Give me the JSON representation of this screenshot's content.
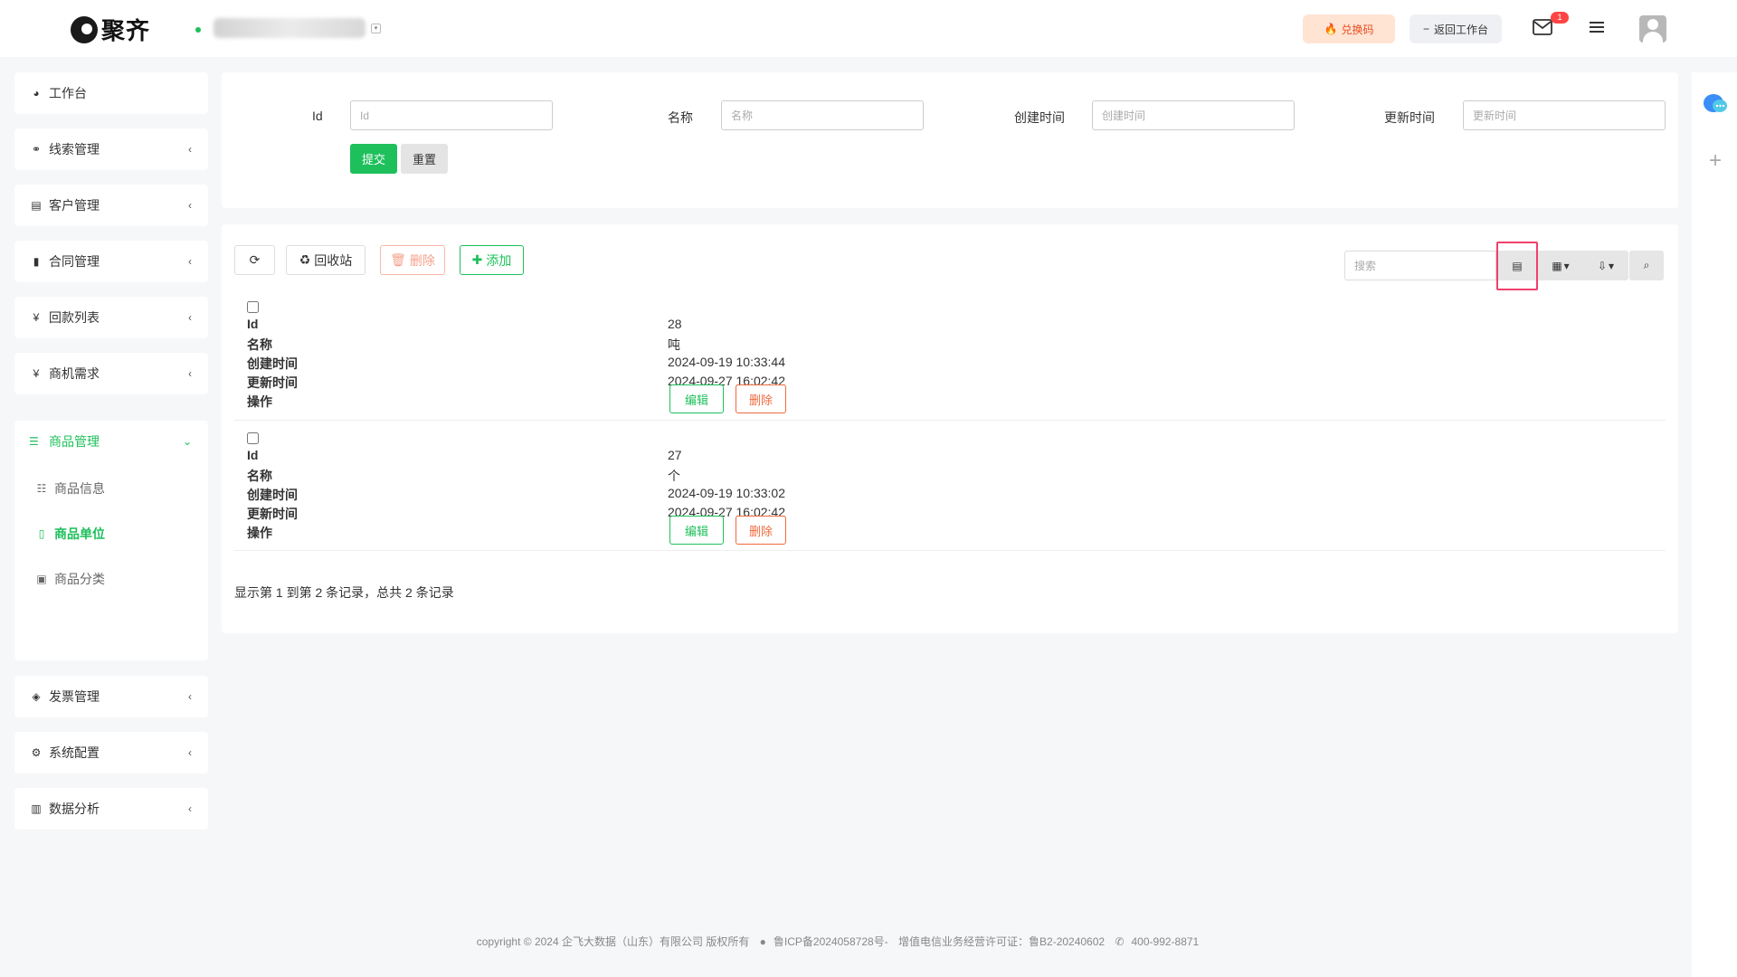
{
  "header": {
    "logo_text": "聚齐",
    "redeem_label": "兑换码",
    "back_label": "返回工作台",
    "mail_badge": "1"
  },
  "sidebar": {
    "items": [
      {
        "label": "工作台",
        "icon": "dashboard-icon"
      },
      {
        "label": "线索管理",
        "icon": "link-icon"
      },
      {
        "label": "客户管理",
        "icon": "id-card-icon"
      },
      {
        "label": "合同管理",
        "icon": "bookmark-icon"
      },
      {
        "label": "回款列表",
        "icon": "yen-icon"
      },
      {
        "label": "商机需求",
        "icon": "yen-icon"
      }
    ],
    "product": {
      "label": "商品管理",
      "sub": [
        {
          "label": "商品信息"
        },
        {
          "label": "商品单位"
        },
        {
          "label": "商品分类"
        }
      ]
    },
    "items_after": [
      {
        "label": "发票管理",
        "icon": "ticket-icon"
      },
      {
        "label": "系统配置",
        "icon": "gears-icon"
      },
      {
        "label": "数据分析",
        "icon": "bar-chart-icon"
      }
    ]
  },
  "filter": {
    "fields": [
      {
        "label": "Id",
        "placeholder": "Id"
      },
      {
        "label": "名称",
        "placeholder": "名称"
      },
      {
        "label": "创建时间",
        "placeholder": "创建时间"
      },
      {
        "label": "更新时间",
        "placeholder": "更新时间"
      }
    ],
    "submit_label": "提交",
    "reset_label": "重置"
  },
  "toolbar": {
    "recycle_label": "回收站",
    "delete_label": "删除",
    "add_label": "添加",
    "search_placeholder": "搜索"
  },
  "table": {
    "columns": [
      "Id",
      "名称",
      "创建时间",
      "更新时间",
      "操作"
    ],
    "rows": [
      {
        "id": "28",
        "name": "吨",
        "created": "2024-09-19 10:33:44",
        "updated": "2024-09-27 16:02:42"
      },
      {
        "id": "27",
        "name": "个",
        "created": "2024-09-19 10:33:02",
        "updated": "2024-09-27 16:02:42"
      }
    ],
    "edit_label": "编辑",
    "delete_label": "删除",
    "pagination_info": "显示第 1 到第 2 条记录，总共 2 条记录"
  },
  "footer": {
    "copyright": "copyright © 2024 企飞大数据（山东）有限公司 版权所有",
    "icp": "鲁ICP备2024058728号-",
    "license": "增值电信业务经营许可证：鲁B2-20240602",
    "phone": "400-992-8871"
  }
}
